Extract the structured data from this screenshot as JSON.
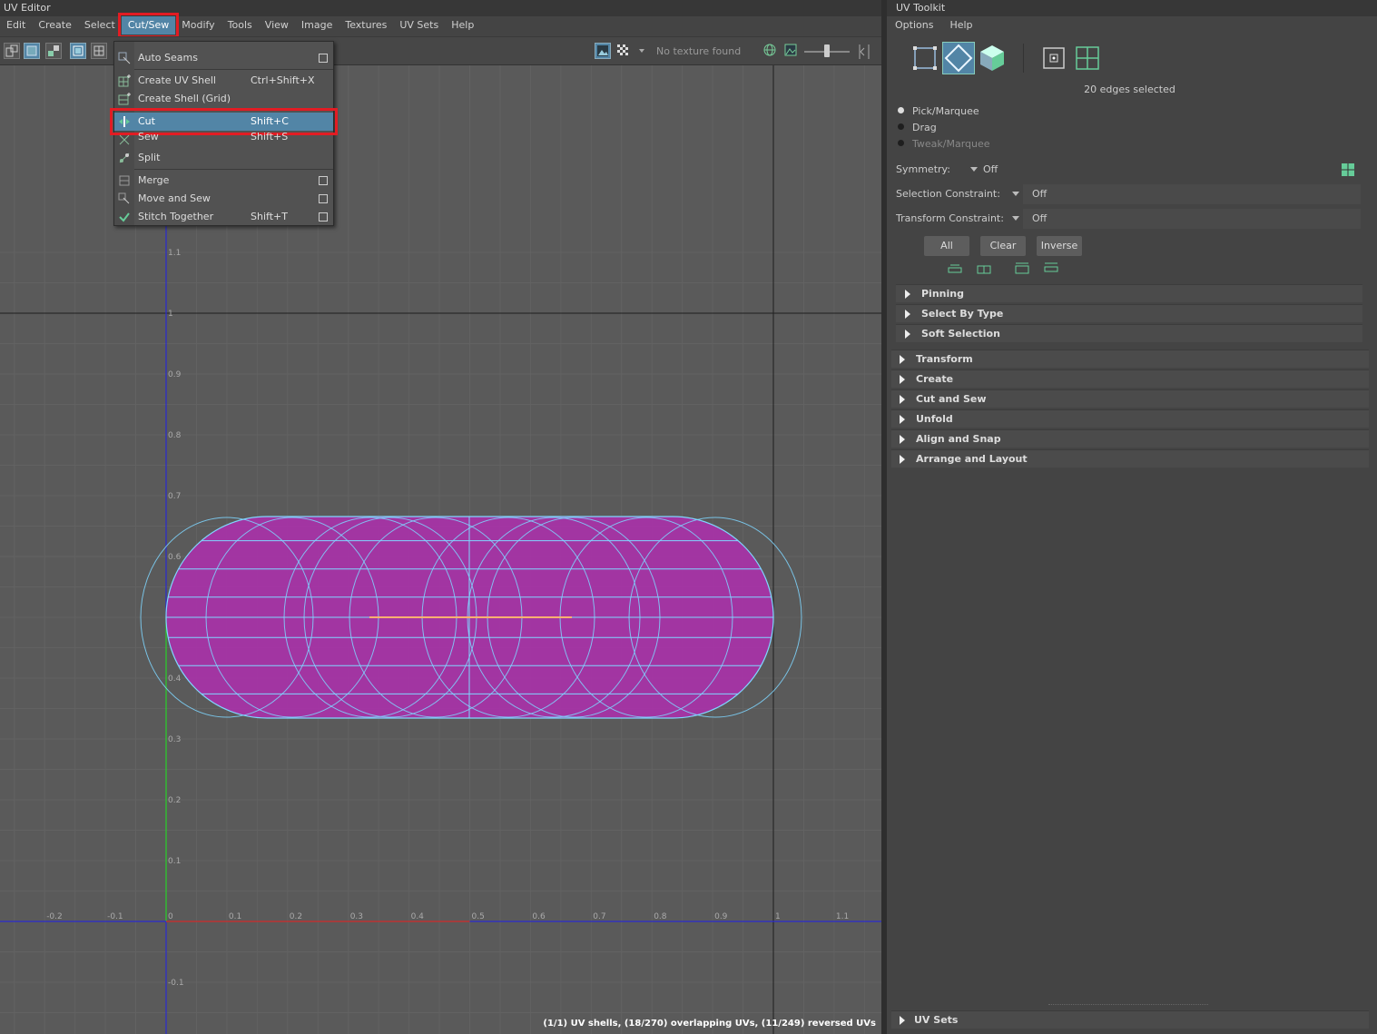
{
  "uv_editor": {
    "title": "UV Editor",
    "menu": [
      "Edit",
      "Create",
      "Select",
      "Cut/Sew",
      "Modify",
      "Tools",
      "View",
      "Image",
      "Textures",
      "UV Sets",
      "Help"
    ],
    "active_menu": "Cut/Sew",
    "texture_label": "No texture found",
    "status_line": "(1/1) UV shells, (18/270) overlapping UVs, (11/249) reversed UVs",
    "axis_labels_x": [
      "-0.2",
      "-0.1",
      "0",
      "0.1",
      "0.2",
      "0.3",
      "0.4",
      "0.5",
      "0.6",
      "0.7",
      "0.8",
      "0.9",
      "1",
      "1.1"
    ],
    "axis_labels_y": [
      "1.1",
      "1",
      "0.9",
      "0.8",
      "0.7",
      "0.6",
      "0.4",
      "0.3",
      "0.2",
      "0.1",
      "-0.1"
    ],
    "colors": {
      "shell_fill": "#a832a8",
      "wire": "#7fd6ff",
      "accent": "#5285a6",
      "highlight_box": "#e21c23"
    }
  },
  "cutsew_menu": {
    "items": [
      {
        "label": "Auto Seams",
        "shortcut": "",
        "has_options": true
      },
      {
        "label": "Create UV Shell",
        "shortcut": "Ctrl+Shift+X",
        "has_options": false
      },
      {
        "label": "Create Shell (Grid)",
        "shortcut": "",
        "has_options": false
      },
      {
        "label": "Cut",
        "shortcut": "Shift+C",
        "has_options": false
      },
      {
        "label": "Sew",
        "shortcut": "Shift+S",
        "has_options": false
      },
      {
        "label": "Split",
        "shortcut": "",
        "has_options": false
      },
      {
        "label": "Merge",
        "shortcut": "",
        "has_options": true
      },
      {
        "label": "Move and Sew",
        "shortcut": "",
        "has_options": true
      },
      {
        "label": "Stitch Together",
        "shortcut": "Shift+T",
        "has_options": true
      }
    ],
    "highlighted": "Cut"
  },
  "uv_toolkit": {
    "title": "UV Toolkit",
    "menu": [
      "Options",
      "Help"
    ],
    "selection_label": "20 edges selected",
    "modes": [
      "Pick/Marquee",
      "Drag",
      "Tweak/Marquee"
    ],
    "selected_mode": "Pick/Marquee",
    "symmetry": {
      "label": "Symmetry:",
      "value": "Off"
    },
    "selection_constraint": {
      "label": "Selection Constraint:",
      "value": "Off"
    },
    "transform_constraint": {
      "label": "Transform Constraint:",
      "value": "Off"
    },
    "buttons": [
      "All",
      "Clear",
      "Inverse"
    ],
    "sections_sub": [
      "Pinning",
      "Select By Type",
      "Soft Selection"
    ],
    "sections": [
      "Transform",
      "Create",
      "Cut and Sew",
      "Unfold",
      "Align and Snap",
      "Arrange and Layout"
    ],
    "bottom_section": "UV Sets"
  }
}
